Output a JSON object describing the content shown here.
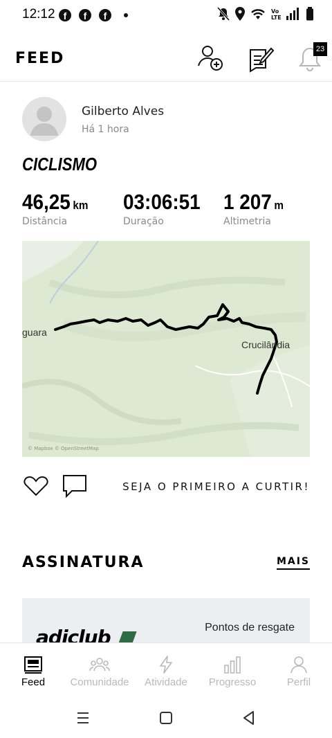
{
  "status_bar": {
    "time": "12:12",
    "icons": [
      "facebook-icon",
      "facebook-icon",
      "facebook-icon",
      "dot",
      "mute-icon",
      "location-icon",
      "wifi-icon",
      "volte-icon",
      "signal-icon",
      "battery-icon"
    ]
  },
  "header": {
    "title": "FEED",
    "notification_count": "23",
    "icons": [
      "add-friend-icon",
      "edit-icon",
      "bell-icon"
    ]
  },
  "post": {
    "user_name": "Gilberto Alves",
    "time_ago": "Há 1 hora",
    "activity_type": "CICLISMO",
    "stats": [
      {
        "value": "46,25",
        "unit": "km",
        "label": "Distância"
      },
      {
        "value": "03:06:51",
        "unit": "",
        "label": "Duração"
      },
      {
        "value": "1 207",
        "unit": "m",
        "label": "Altimetria"
      }
    ],
    "map": {
      "place_left": "guara",
      "place_right": "Crucilândia",
      "attribution": "© Mapbox  © OpenStreetMap"
    },
    "like_cta": "SEJA O PRIMEIRO A CURTIR!"
  },
  "subscription": {
    "title": "ASSINATURA",
    "more": "MAIS",
    "promo": {
      "logo": "adiclub",
      "points_label": "Pontos de resgate"
    }
  },
  "bottom_nav": [
    {
      "label": "Feed",
      "active": true
    },
    {
      "label": "Comunidade",
      "active": false
    },
    {
      "label": "Atividade",
      "active": false
    },
    {
      "label": "Progresso",
      "active": false
    },
    {
      "label": "Perfil",
      "active": false
    }
  ],
  "colors": {
    "accent": "#000000",
    "inactive": "#b9b9b9",
    "map_bg": "#dde9d2",
    "route": "#000000"
  }
}
